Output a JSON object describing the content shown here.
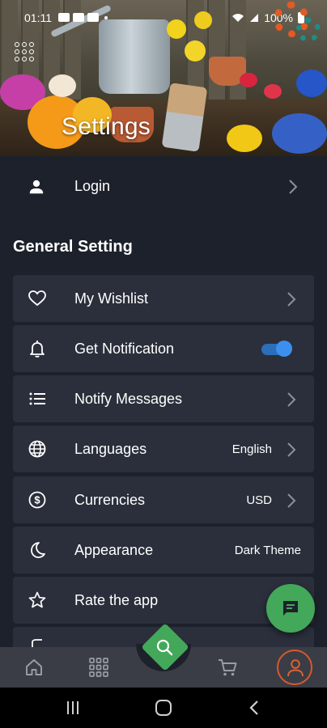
{
  "status_bar": {
    "time": "01:11",
    "battery": "100%"
  },
  "header": {
    "title": "Settings"
  },
  "login": {
    "label": "Login"
  },
  "general": {
    "title": "General Setting",
    "items": [
      {
        "label": "My Wishlist",
        "icon": "heart-icon"
      },
      {
        "label": "Get Notification",
        "icon": "bell-icon",
        "toggle_on": true
      },
      {
        "label": "Notify Messages",
        "icon": "list-icon"
      },
      {
        "label": "Languages",
        "icon": "globe-icon",
        "value": "English"
      },
      {
        "label": "Currencies",
        "icon": "dollar-icon",
        "value": "USD"
      },
      {
        "label": "Appearance",
        "icon": "moon-icon",
        "value": "Dark Theme"
      },
      {
        "label": "Rate the app",
        "icon": "star-icon"
      }
    ]
  },
  "colors": {
    "background": "#1d212b",
    "card": "#2a2f3b",
    "accent_green": "#43a85a",
    "toggle_blue": "#3d8fef",
    "profile_orange": "#d9582c",
    "nav_bar": "#3a3d45"
  },
  "bottom_nav": {
    "items": [
      "home-icon",
      "categories-icon",
      "search-icon",
      "cart-icon",
      "profile-icon"
    ],
    "active": "profile-icon"
  }
}
